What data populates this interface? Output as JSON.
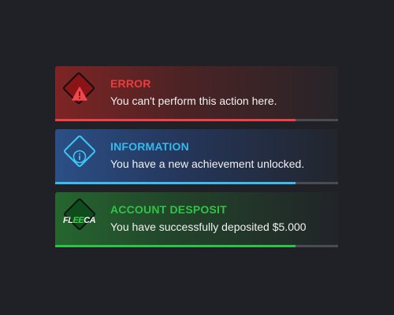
{
  "colors": {
    "background": "#1f2126",
    "error_accent": "#f03a3c",
    "info_accent": "#35b9ec",
    "success_accent": "#2fc444"
  },
  "notifications": [
    {
      "type": "error",
      "icon": "warning-icon",
      "title": "ERROR",
      "message": "You can't perform this action here.",
      "progress": 0.85
    },
    {
      "type": "info",
      "icon": "info-icon",
      "title": "INFORMATION",
      "message": "You have a new achievement unlocked.",
      "progress": 0.85
    },
    {
      "type": "money",
      "icon": "fleeca-logo-icon",
      "logo_text": "FLEECA",
      "title": "ACCOUNT DESPOSIT",
      "message": "You have successfully deposited $5.000",
      "progress": 0.85
    }
  ]
}
